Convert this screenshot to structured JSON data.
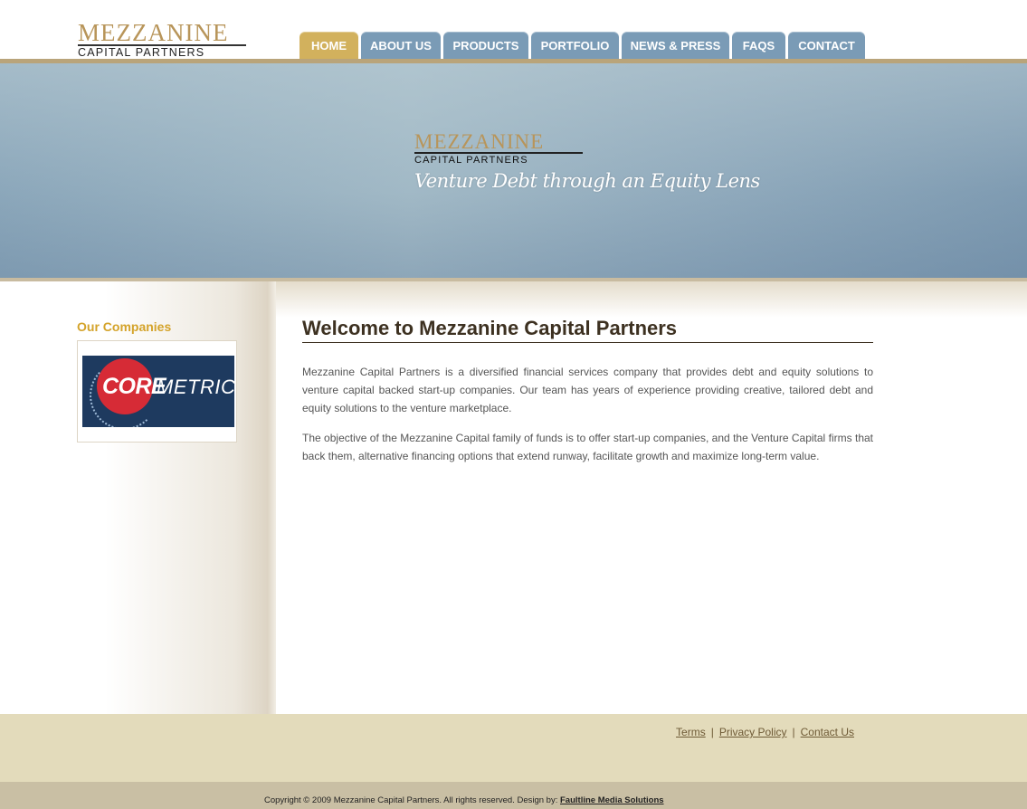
{
  "logo": {
    "top": "MEZZANINE",
    "bottom": "CAPITAL PARTNERS"
  },
  "nav": {
    "tabs": [
      {
        "label": "HOME",
        "active": true
      },
      {
        "label": "ABOUT US",
        "active": false
      },
      {
        "label": "PRODUCTS",
        "active": false
      },
      {
        "label": "PORTFOLIO",
        "active": false
      },
      {
        "label": "NEWS & PRESS",
        "active": false
      },
      {
        "label": "FAQS",
        "active": false
      },
      {
        "label": "CONTACT",
        "active": false
      }
    ]
  },
  "banner": {
    "logo_top": "MEZZANINE",
    "logo_bottom": "CAPITAL PARTNERS",
    "tagline": "Venture Debt through an Equity Lens"
  },
  "sidebar": {
    "title": "Our Companies",
    "company": {
      "core": "CORE",
      "metrics": "METRICS"
    }
  },
  "main": {
    "title": "Welcome to Mezzanine Capital Partners",
    "p1": "Mezzanine Capital Partners is a diversified financial services company that provides debt and equity solutions to venture capital backed start-up companies. Our team has years of experience providing creative, tailored debt and equity solutions to the venture marketplace.",
    "p2": "The objective of the Mezzanine Capital family of funds is to offer start-up companies, and the Venture Capital firms that back them, alternative financing options that extend runway, facilitate growth and maximize long-term value."
  },
  "footer": {
    "links": {
      "terms": "Terms",
      "privacy": "Privacy Policy",
      "contact": "Contact Us",
      "sep": "|"
    },
    "copyright": "Copyright © 2009 Mezzanine Capital Partners. All rights reserved. Design by:",
    "designer": "Faultline Media Solutions"
  },
  "colors": {
    "accent": "#d2b15d",
    "nav": "#7a9bb6",
    "footer": "#e3dbbb"
  }
}
